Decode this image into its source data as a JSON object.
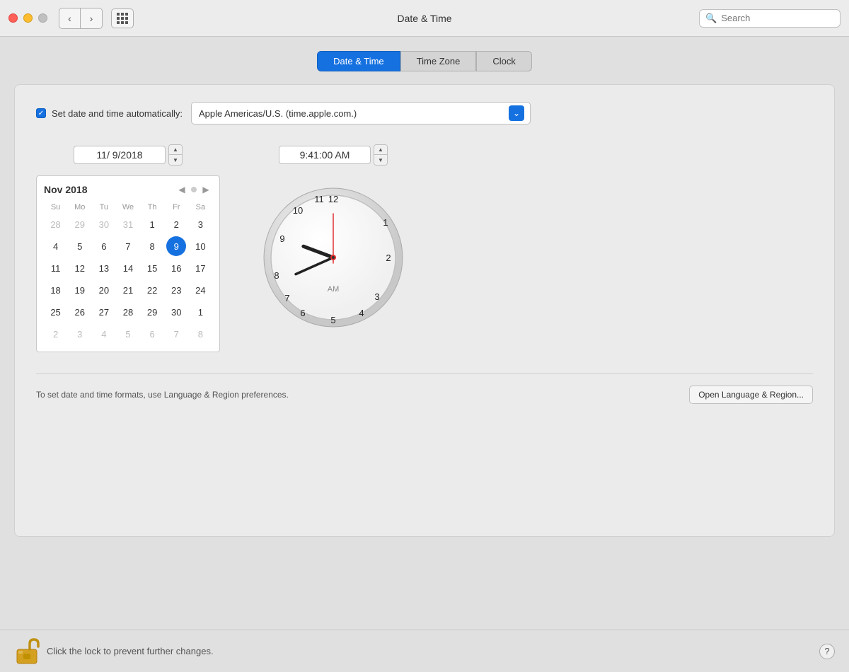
{
  "titlebar": {
    "title": "Date & Time",
    "search_placeholder": "Search"
  },
  "tabs": [
    {
      "id": "date-time",
      "label": "Date & Time",
      "active": true
    },
    {
      "id": "time-zone",
      "label": "Time Zone",
      "active": false
    },
    {
      "id": "clock",
      "label": "Clock",
      "active": false
    }
  ],
  "settings": {
    "auto_set_label": "Set date and time automatically:",
    "server_value": "Apple Americas/U.S. (time.apple.com.)",
    "date_value": "11/  9/2018",
    "time_value": "9:41:00 AM",
    "calendar": {
      "month_label": "Nov 2018",
      "day_headers": [
        "Su",
        "Mo",
        "Tu",
        "We",
        "Th",
        "Fr",
        "Sa"
      ],
      "weeks": [
        [
          "28",
          "29",
          "30",
          "31",
          "1",
          "2",
          "3"
        ],
        [
          "4",
          "5",
          "6",
          "7",
          "8",
          "9",
          "10"
        ],
        [
          "11",
          "12",
          "13",
          "14",
          "15",
          "16",
          "17"
        ],
        [
          "18",
          "19",
          "20",
          "21",
          "22",
          "23",
          "24"
        ],
        [
          "25",
          "26",
          "27",
          "28",
          "29",
          "30",
          "1"
        ],
        [
          "2",
          "3",
          "4",
          "5",
          "6",
          "7",
          "8"
        ]
      ],
      "selected_day": "9",
      "selected_week": 1,
      "selected_col": 5
    },
    "bottom_text": "To set date and time formats, use Language & Region preferences.",
    "open_region_btn": "Open Language & Region...",
    "am_label": "AM"
  },
  "footer": {
    "lock_text": "Click the lock to prevent further changes.",
    "help_label": "?"
  },
  "clock": {
    "hour_angle": 283,
    "minute_angle": 246,
    "second_angle": 0
  }
}
